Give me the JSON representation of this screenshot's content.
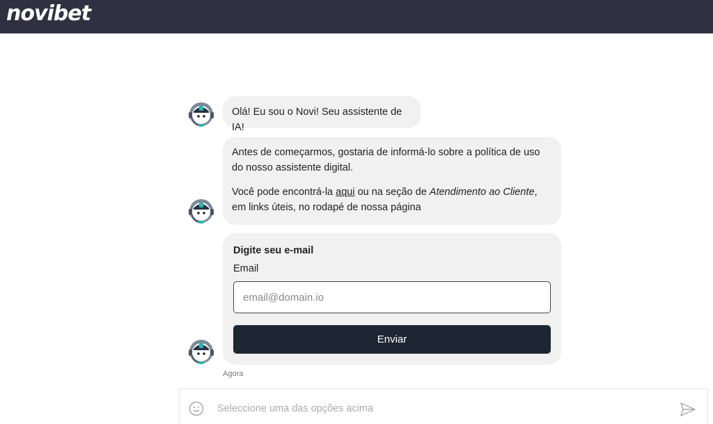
{
  "header": {
    "logo_text": "novibet",
    "background_color": "#2f3140"
  },
  "messages": [
    {
      "text": "Olá! Eu sou o Novi! Seu assistente de IA!"
    },
    {
      "p1": "Antes de começarmos, gostaria de informá-lo sobre a política de uso do nosso assistente digital.",
      "p2_before": "Você pode encontrá-la ",
      "p2_link": "aqui",
      "p2_middle": " ou na seção de ",
      "p2_emphasis": "Atendimento ao Cliente",
      "p2_after": ", em links úteis, no rodapé de nossa página"
    }
  ],
  "email_form": {
    "title": "Digite seu e-mail",
    "field_label": "Email",
    "placeholder": "email@domain.io",
    "value": "",
    "submit_label": "Enviar"
  },
  "timestamp": "Agora",
  "composer": {
    "placeholder": "Seleccione uma das opções acima",
    "emoji_icon": "smiley-icon",
    "send_icon": "paper-plane-icon"
  },
  "bot_avatar_icon": "robot-headset-icon",
  "colors": {
    "accent": "#1f2633",
    "bubble": "#f1f1f1",
    "avatar_teal": "#2bb5b5"
  }
}
